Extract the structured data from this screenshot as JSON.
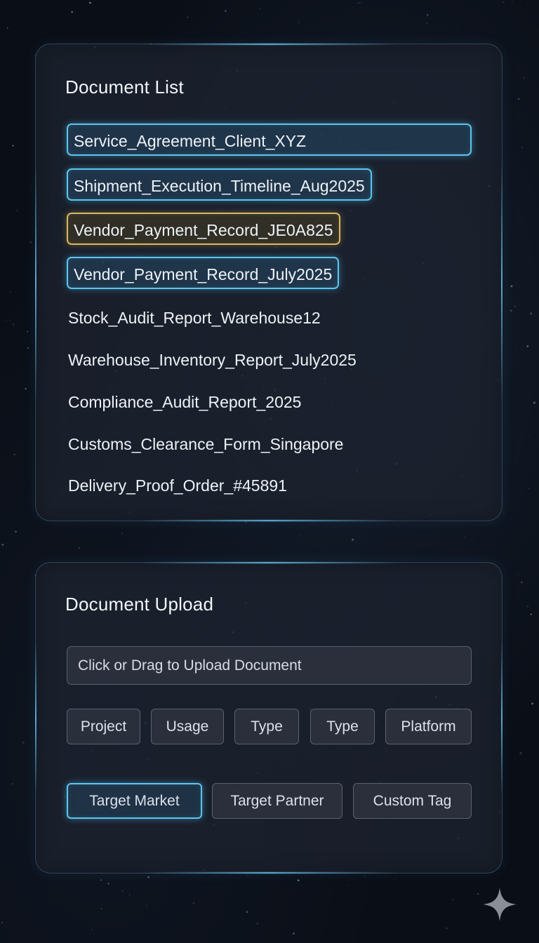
{
  "document_list": {
    "title": "Document List",
    "items": [
      {
        "name": "Service_Agreement_Client_XYZ",
        "state": "selected"
      },
      {
        "name": "Shipment_Execution_Timeline_Aug2025",
        "state": "selected"
      },
      {
        "name": "Vendor_Payment_Record_JE0A825",
        "state": "highlighted"
      },
      {
        "name": "Vendor_Payment_Record_July2025",
        "state": "selected"
      },
      {
        "name": "Stock_Audit_Report_Warehouse12",
        "state": "normal"
      },
      {
        "name": "Warehouse_Inventory_Report_July2025",
        "state": "normal"
      },
      {
        "name": "Compliance_Audit_Report_2025",
        "state": "normal"
      },
      {
        "name": "Customs_Clearance_Form_Singapore",
        "state": "normal"
      },
      {
        "name": "Delivery_Proof_Order_#45891",
        "state": "normal"
      }
    ]
  },
  "document_upload": {
    "title": "Document Upload",
    "dropzone_label": "Click or Drag to Upload Document",
    "tags_row1": [
      "Project",
      "Usage",
      "Type",
      "Type",
      "Platform"
    ],
    "tags_row2": [
      "Target Market",
      "Target Partner",
      "Custom Tag"
    ],
    "active_tag": "Target Market"
  },
  "colors": {
    "selected_border": "#5cc6ee",
    "highlight_border": "#d9b862",
    "background": "#0a0e16",
    "panel": "#1c222e"
  },
  "icons": {
    "corner": "sparkle-icon"
  }
}
